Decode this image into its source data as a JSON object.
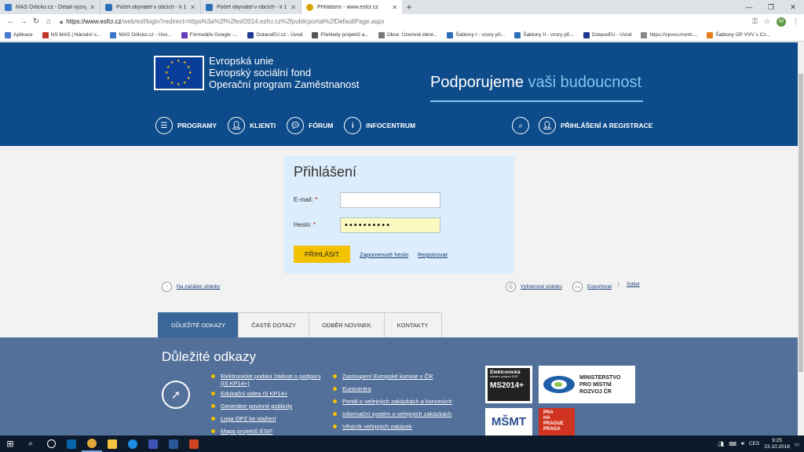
{
  "browser": {
    "tabs": [
      {
        "title": "MAS Orlicko.cz - Detail výzvy",
        "icon": "mas-icon",
        "color": "#3a77c8"
      },
      {
        "title": "Počet obyvatel v obcích - k 1.1.2018",
        "icon": "doc-icon",
        "color": "#2d6fb6"
      },
      {
        "title": "Počet obyvatel v obcích - k 1.1.2018",
        "icon": "doc-icon",
        "color": "#2d6fb6"
      },
      {
        "title": "Přihlášení - www.esfcr.cz",
        "icon": "esf-icon",
        "color": "#d8a400"
      }
    ],
    "url_host": "https://www.esfcr.cz",
    "url_path": "/web/esf/login?redirect=https%3a%2f%2fesf2014.esfcr.cz%2fpublicportal%2fDefaultPage.aspx",
    "profile_initial": "M",
    "bookmarks": [
      {
        "label": "Aplikace",
        "color": "#4a7bd0"
      },
      {
        "label": "NS MAS | Národní s...",
        "color": "#c0392b"
      },
      {
        "label": "MAS Orlicko.cz - Úvo...",
        "color": "#3a77c8"
      },
      {
        "label": "Formuláře Google -...",
        "color": "#673ab7"
      },
      {
        "label": "DotaceEU.cz - Úvod",
        "color": "#1f3a93"
      },
      {
        "label": "Přehledy projektů a...",
        "color": "#555555"
      },
      {
        "label": "Obce: Územně ident...",
        "color": "#777777"
      },
      {
        "label": "Šablony I - vzory při...",
        "color": "#2d6fb6"
      },
      {
        "label": "Šablony II - vzory při...",
        "color": "#2d6fb6"
      },
      {
        "label": "DotaceEU - Úvod",
        "color": "#1f3a93"
      },
      {
        "label": "https://opvvv.msmt....",
        "color": "#888888"
      },
      {
        "label": "Šablony OP VVV s Cz...",
        "color": "#e67e22"
      }
    ]
  },
  "header": {
    "eu_lines": [
      "Evropská unie",
      "Evropský sociální fond",
      "Operační program Zaměstnanost"
    ],
    "slogan_a": "Podporujeme",
    "slogan_b": "vaši budoucnost",
    "nav": [
      {
        "label": "PROGRAMY",
        "icon": "list-icon"
      },
      {
        "label": "KLIENTI",
        "icon": "user-icon"
      },
      {
        "label": "FÓRUM",
        "icon": "chat-icon"
      },
      {
        "label": "INFOCENTRUM",
        "icon": "info-icon"
      }
    ],
    "login_link": "PŘIHLÁŠENÍ A REGISTRACE"
  },
  "login": {
    "title": "Přihlášení",
    "email_label": "E-mail:",
    "password_label": "Heslo:",
    "required_mark": "*",
    "email_value": "",
    "password_value": "••••••••••",
    "submit": "PŘIHLÁSIT",
    "forgot": "Zapomenuté heslo",
    "register": "Registrovat"
  },
  "utility": {
    "top": "Na začátek stránky",
    "print": "Vytisknout stránku",
    "export": "Exportovat",
    "separator": "|",
    "share": "Sdílet"
  },
  "info_tabs": [
    "DŮLEŽITÉ ODKAZY",
    "ČASTÉ DOTAZY",
    "ODBĚR NOVINEK",
    "KONTAKTY"
  ],
  "links": {
    "title": "Důležité odkazy",
    "col1": [
      "Elektronické podání žádosti o podporu (IS KP14+)",
      "Edukační videa IS KP14+",
      "Generátor povinné publicity",
      "Loga OPZ ke stažení",
      "Mapa projektů ESIF"
    ],
    "col2": [
      "Zastoupení Evropské komise v ČR",
      "Eurocentra",
      "Portál o veřejných zakázkách a koncesích",
      "Informační systém o veřejných zakázkách",
      "Věstník veřejných zakázek"
    ],
    "partners": {
      "ms2014_top": "Elektronická",
      "ms2014_sub": "žádost o podporu ESIF",
      "ms2014_logo": "MS2014+",
      "mmr": [
        "MINISTERSTVO",
        "PRO MÍSTNÍ",
        "ROZVOJ ČR"
      ],
      "msmt": "MŠMT",
      "praha": [
        "PRA",
        "HA",
        "PRAGUE",
        "PRAGA"
      ]
    }
  },
  "taskbar": {
    "lang": "CES",
    "time": "9:25",
    "date": "23.10.2018"
  }
}
